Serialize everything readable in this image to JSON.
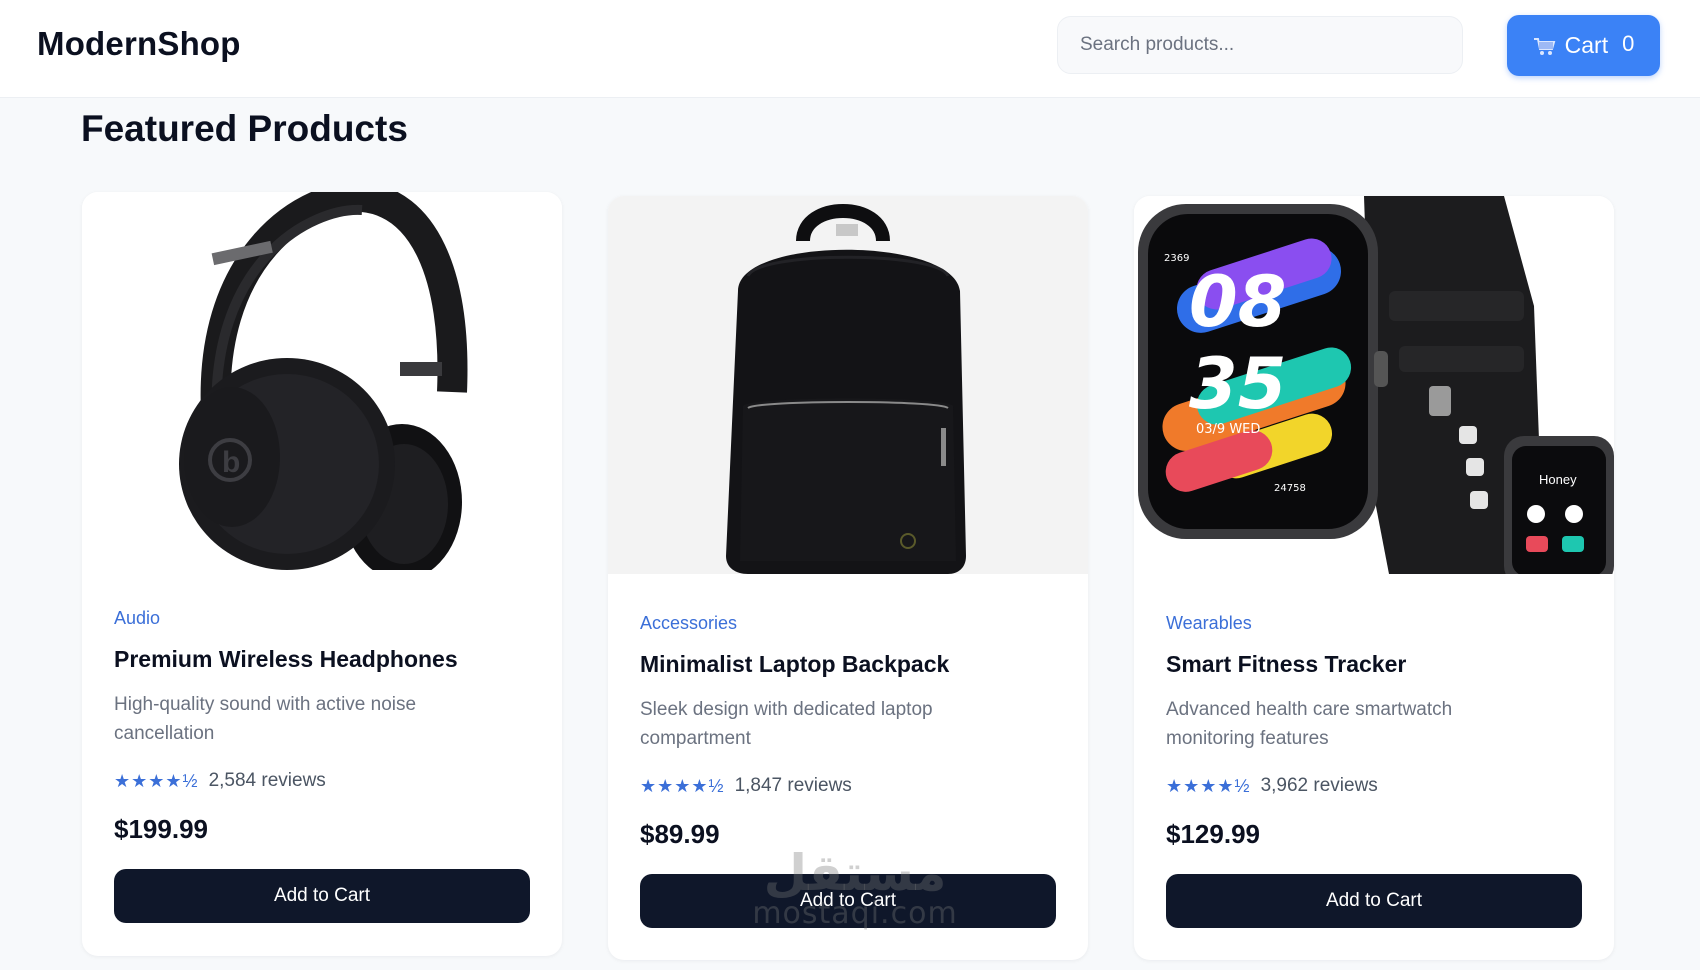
{
  "header": {
    "logo": "ModernShop",
    "search_placeholder": "Search products...",
    "cart_label": "Cart",
    "cart_count": "0",
    "accent_color": "#3b82f6"
  },
  "main": {
    "title": "Featured Products"
  },
  "products": [
    {
      "image_icon": "headphones-image",
      "category": "Audio",
      "name": "Premium Wireless Headphones",
      "description": "High-quality sound with active noise cancellation",
      "stars": "★★★★½",
      "rating": 4.5,
      "reviews": "2,584 reviews",
      "price": "$199.99",
      "button": "Add to Cart"
    },
    {
      "image_icon": "backpack-image",
      "category": "Accessories",
      "name": "Minimalist Laptop Backpack",
      "description": "Sleek design with dedicated laptop compartment",
      "stars": "★★★★½",
      "rating": 4.5,
      "reviews": "1,847 reviews",
      "price": "$89.99",
      "button": "Add to Cart"
    },
    {
      "image_icon": "smartwatch-image",
      "category": "Wearables",
      "name": "Smart Fitness Tracker",
      "description": "Advanced health care smartwatch monitoring features",
      "stars": "★★★★½",
      "rating": 4.5,
      "reviews": "3,962 reviews",
      "price": "$129.99",
      "button": "Add to Cart",
      "watch": {
        "hour": "08",
        "minute": "35",
        "date": "03/9 WED",
        "top_number": "2369",
        "bottom_number": "24758",
        "small_watch_label": "Honey"
      }
    }
  ],
  "watermark": {
    "logo": "مستقل",
    "text": "mostaqi.com"
  }
}
